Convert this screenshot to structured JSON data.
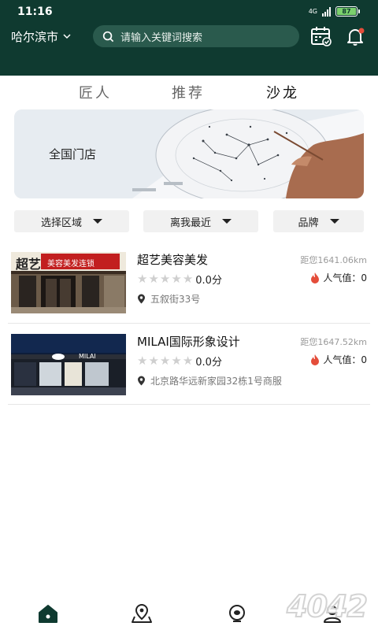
{
  "status_bar": {
    "time": "11:16",
    "network": "4G",
    "battery": "87"
  },
  "header": {
    "city": "哈尔滨市",
    "search_placeholder": "请输入关键词搜索",
    "icons": [
      "calendar-check-icon",
      "bell-icon"
    ]
  },
  "tabs": [
    {
      "label": "匠人",
      "active": false
    },
    {
      "label": "推荐",
      "active": false
    },
    {
      "label": "沙龙",
      "active": true
    }
  ],
  "banner": {
    "title": "全国门店"
  },
  "filters": [
    {
      "label": "选择区域"
    },
    {
      "label": "离我最近"
    },
    {
      "label": "品牌"
    }
  ],
  "stores": [
    {
      "name": "超艺美容美发",
      "distance": "距您1641.06km",
      "rating": "0.0分",
      "stars": 0,
      "popularity": "人气值：0",
      "address": "五叙街33号",
      "sign_text": "超艺",
      "sign_sub": "美容美发连锁"
    },
    {
      "name": "MILAI国际形象设计",
      "distance": "距您1647.52km",
      "rating": "0.0分",
      "stars": 0,
      "popularity": "人气值：0",
      "address": "北京路华远新家园32栋1号商服",
      "sign_text": "MILAI"
    }
  ],
  "bottom_nav": [
    {
      "name": "home-icon",
      "active": true
    },
    {
      "name": "map-pin-icon",
      "active": false
    },
    {
      "name": "discover-icon",
      "active": false
    },
    {
      "name": "profile-icon",
      "active": false
    }
  ],
  "watermark": "4042",
  "colors": {
    "header_bg": "#0f3a30",
    "accent": "#e44d3a"
  }
}
